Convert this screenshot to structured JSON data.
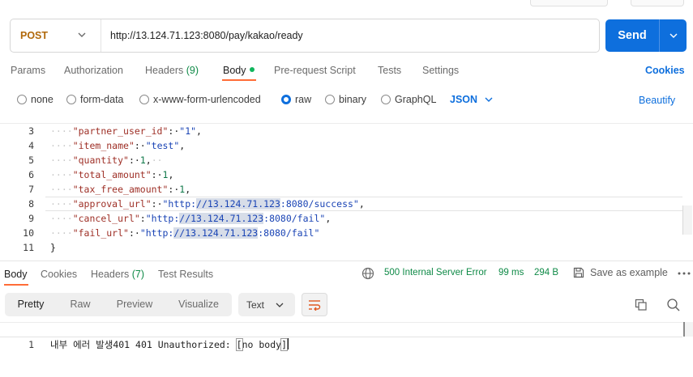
{
  "request": {
    "method": "POST",
    "url": "http://13.124.71.123:8080/pay/kakao/ready",
    "send_label": "Send"
  },
  "request_tabs": {
    "params": "Params",
    "authorization": "Authorization",
    "headers": "Headers",
    "headers_count": "(9)",
    "body": "Body",
    "pre_request": "Pre-request Script",
    "tests": "Tests",
    "settings": "Settings",
    "cookies": "Cookies"
  },
  "body_options": {
    "none": "none",
    "form_data": "form-data",
    "urlencoded": "x-www-form-urlencoded",
    "raw": "raw",
    "binary": "binary",
    "graphql": "GraphQL",
    "selected": "raw",
    "language": "JSON",
    "beautify": "Beautify"
  },
  "editor": {
    "lines": [
      {
        "num": "3",
        "key": "\"partner_user_id\"",
        "value": "\"1\"",
        "trail": ","
      },
      {
        "num": "4",
        "key": "\"item_name\"",
        "value": "\"test\"",
        "trail": ","
      },
      {
        "num": "5",
        "key": "\"quantity\"",
        "value": "1",
        "trail": ","
      },
      {
        "num": "6",
        "key": "\"total_amount\"",
        "value": "1",
        "trail": ","
      },
      {
        "num": "7",
        "key": "\"tax_free_amount\"",
        "value": "1",
        "trail": ","
      },
      {
        "num": "8",
        "key": "\"approval_url\"",
        "value_pre": "\"http:",
        "value_hl": "//13.124.71.123",
        "value_post": ":8080/success\"",
        "trail": ","
      },
      {
        "num": "9",
        "key": "\"cancel_url\"",
        "value_pre": "\"http:",
        "value_hl": "//13.124.71.123",
        "value_post": ":8080/fail\"",
        "trail": ","
      },
      {
        "num": "10",
        "key": "\"fail_url\"",
        "value_pre": "\"http:",
        "value_hl": "//13.124.71.123",
        "value_post": ":8080/fail\"",
        "trail": ""
      },
      {
        "num": "11",
        "close": "}"
      }
    ]
  },
  "response_tabs": {
    "body": "Body",
    "cookies": "Cookies",
    "headers": "Headers",
    "headers_count": "(7)",
    "test_results": "Test Results"
  },
  "response_status": {
    "status": "500 Internal Server Error",
    "time": "99 ms",
    "size": "294 B",
    "save_example": "Save as example"
  },
  "response_view": {
    "pretty": "Pretty",
    "raw": "Raw",
    "preview": "Preview",
    "visualize": "Visualize",
    "format": "Text"
  },
  "response_body": {
    "line_num": "1",
    "text": "내부 에러 발생401 401 Unauthorized: ",
    "bracket_open": "[",
    "inner": "no body",
    "bracket_close": "]"
  },
  "colors": {
    "accent": "#0e6fdd",
    "active_tab": "#ff6c37",
    "method": "#b0680a",
    "status_error": "#0f8a47"
  }
}
